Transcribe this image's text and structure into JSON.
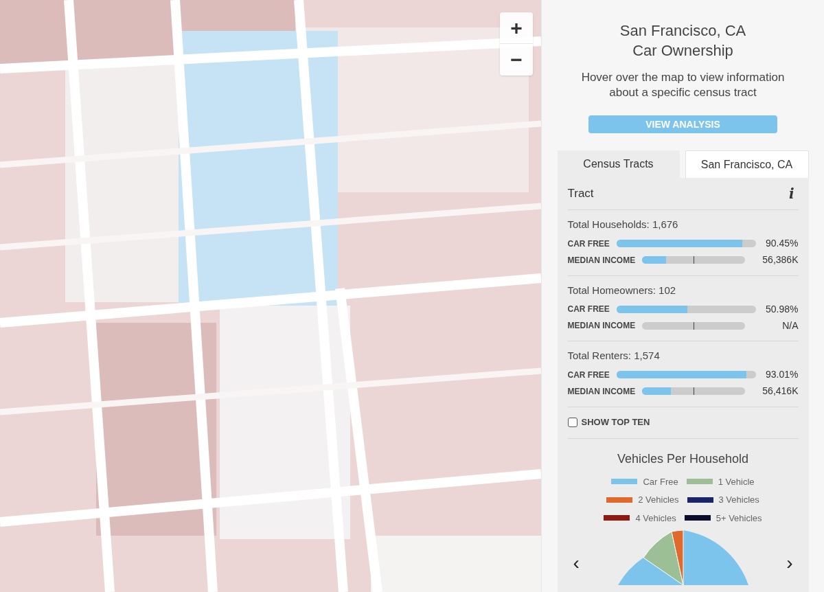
{
  "map": {
    "zoom_controls": [
      "+",
      "−"
    ]
  },
  "sidebar": {
    "title": [
      "San Francisco, CA",
      "Car Ownership"
    ],
    "subtitle": "Hover over the map to view information about a specific census tract",
    "button": "VIEW ANALYSIS",
    "tabs": [
      {
        "label": "Census Tracts",
        "selected": true
      },
      {
        "label": "San Francisco, CA",
        "selected": false
      }
    ],
    "panel": {
      "heading": "Tract",
      "info_icon": "i",
      "sections": [
        {
          "title": "Total Households: 1,676",
          "metrics": [
            {
              "label": "CAR FREE",
              "kind": "share",
              "level": 0.9045,
              "reading": "90.45%"
            },
            {
              "label": "MEDIAN INCOME",
              "kind": "income",
              "level": 0.23,
              "reading": "56,386K"
            }
          ]
        },
        {
          "title": "Total Homeowners: 102",
          "metrics": [
            {
              "label": "CAR FREE",
              "kind": "share",
              "level": 0.5098,
              "reading": "50.98%"
            },
            {
              "label": "MEDIAN INCOME",
              "kind": "income",
              "level": 0,
              "reading": "N/A"
            }
          ]
        },
        {
          "title": "Total Renters: 1,574",
          "metrics": [
            {
              "label": "CAR FREE",
              "kind": "share",
              "level": 0.9301,
              "reading": "93.01%"
            },
            {
              "label": "MEDIAN INCOME",
              "kind": "income",
              "level": 0.28,
              "reading": "56,416K"
            }
          ]
        }
      ],
      "show_top_ten": {
        "label": "SHOW TOP TEN",
        "checked": false
      },
      "chart": {
        "title": "Vehicles Per Household",
        "legend": [
          {
            "label": "Car Free",
            "color": "#7cc4ec"
          },
          {
            "label": "1 Vehicle",
            "color": "#9dbf96"
          },
          {
            "label": "2 Vehicles",
            "color": "#e06a2c"
          },
          {
            "label": "3 Vehicles",
            "color": "#1a2466"
          },
          {
            "label": "4 Vehicles",
            "color": "#8c1a12"
          },
          {
            "label": "5+ Vehicles",
            "color": "#0b0e2a"
          }
        ],
        "prev": "‹",
        "next": "›"
      }
    }
  }
}
